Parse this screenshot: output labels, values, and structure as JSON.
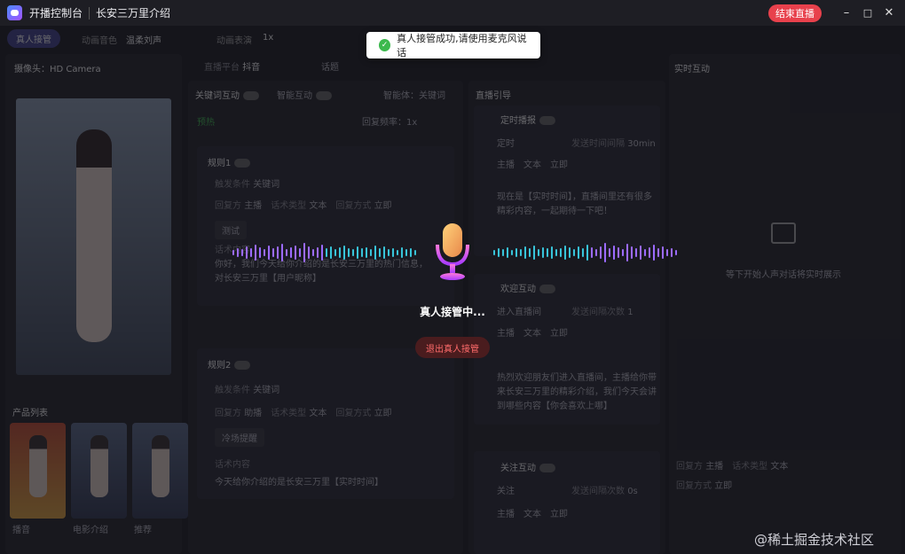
{
  "window": {
    "app_name": "开播控制台",
    "title": "长安三万里介绍",
    "end_live_label": "结束直播",
    "minimize": "–",
    "maximize": "□",
    "close": "✕"
  },
  "toast": {
    "message": "真人接管成功,请使用麦克风说话"
  },
  "modal": {
    "title": "真人接管中...",
    "exit_label": "退出真人接管"
  },
  "tabs": {
    "active": "真人接管",
    "item1_label": "动画音色",
    "item1_value": "温柔刘声",
    "item2_label": "动画表演",
    "item2_value": "1x"
  },
  "camera": {
    "label": "摄像头：",
    "value": "HD Camera"
  },
  "platform": {
    "label": "直播平台",
    "value": "抖音",
    "opt2": "话题"
  },
  "products": {
    "title": "产品列表",
    "items": [
      {
        "name": "播音"
      },
      {
        "name": "电影介绍"
      },
      {
        "name": "推荐"
      }
    ]
  },
  "keyword": {
    "title": "关键词互动",
    "toggle2": "智能互动",
    "selector": "智能体：关键词",
    "scheme": "预热",
    "reply_rate": "回复频率：1x"
  },
  "rules": [
    {
      "name": "规则1",
      "trigger_label": "触发条件",
      "trigger": "关键词",
      "role_label": "回复方",
      "role": "主播",
      "script_label": "话术类型",
      "script": "文本",
      "reply_label": "回复方式",
      "reply": "立即",
      "keyword": "测试",
      "content_label": "话术内容",
      "content": "你好，我们今天给你介绍的是长安三万里的热门信息，对长安三万里【用户昵称】"
    },
    {
      "name": "规则2",
      "trigger_label": "触发条件",
      "trigger": "关键词",
      "role_label": "回复方",
      "role": "助播",
      "script_label": "话术类型",
      "script": "文本",
      "reply_label": "回复方式",
      "reply": "立即",
      "keyword": "冷场提醒",
      "content_label": "话术内容",
      "content": "今天给你介绍的是长安三万里【实时时间】"
    }
  ],
  "guide": {
    "title": "直播引导",
    "sections": [
      {
        "name": "定时播报",
        "trigger": "定时",
        "interval_label": "发送时间间隔",
        "interval": "30min",
        "role": "主播",
        "script": "文本",
        "reply": "立即",
        "content": "现在是【实时时间】，直播间里还有很多精彩内容，一起期待一下吧！"
      },
      {
        "name": "欢迎互动",
        "trigger": "进入直播间",
        "interval_label": "发送间隔次数",
        "interval": "1",
        "role": "主播",
        "script": "文本",
        "reply": "立即",
        "content": "热烈欢迎朋友们进入直播间，主播给你带来长安三万里的精彩介绍，我们今天会讲到哪些内容【你会喜欢上哪】"
      },
      {
        "name": "关注互动",
        "trigger": "关注",
        "interval_label": "发送间隔次数",
        "interval": "0s",
        "role": "主播",
        "script": "文本",
        "reply": "立即"
      }
    ]
  },
  "live": {
    "title": "实时互动",
    "empty": "等下开始人声对话将实时展示",
    "role_label": "回复方",
    "role": "主播",
    "script_label": "话术类型",
    "script": "文本",
    "reply_label": "回复方式",
    "reply": "立即"
  },
  "watermark": "@稀土掘金技术社区",
  "colors": {
    "accent": "#e8414c",
    "success": "#3cb94d"
  }
}
